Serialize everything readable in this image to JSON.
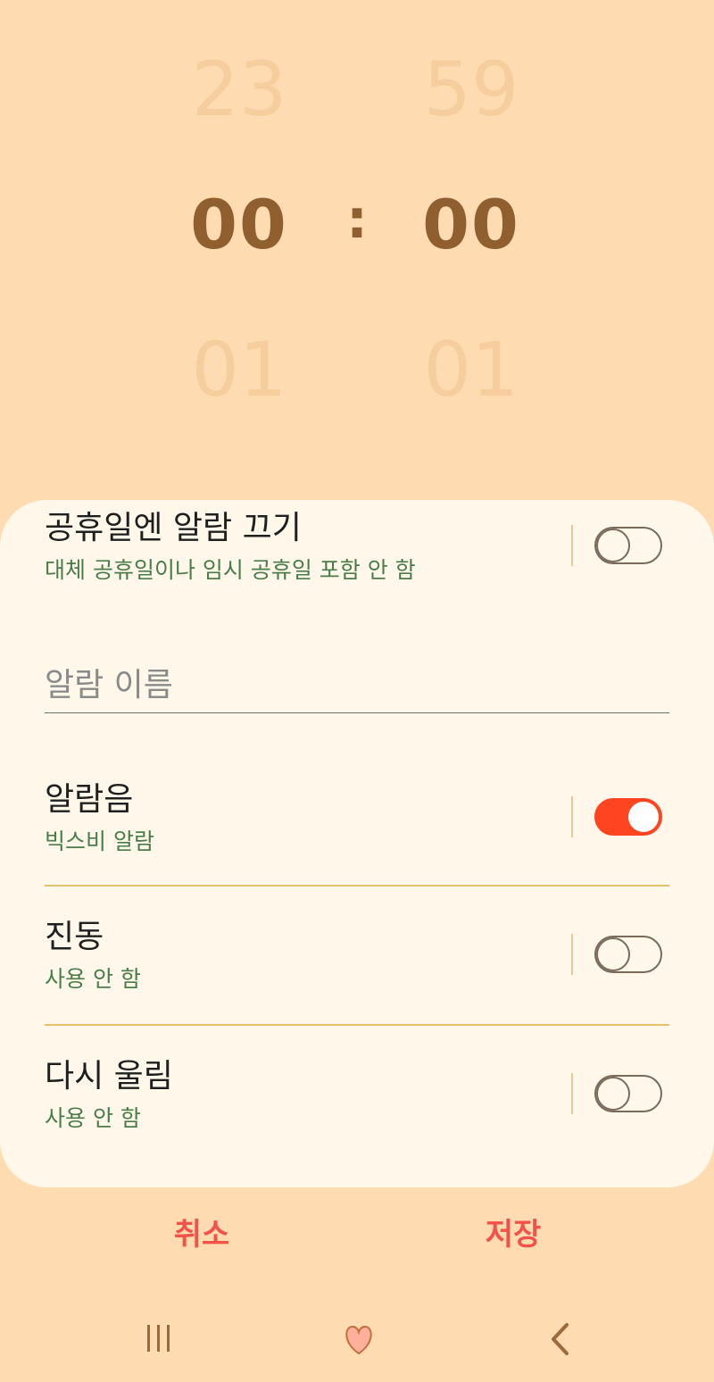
{
  "picker": {
    "hour_prev": "23",
    "hour_current": "00",
    "hour_next": "01",
    "separator": ":",
    "minute_prev": "59",
    "minute_current": "00",
    "minute_next": "01"
  },
  "settings": {
    "holiday": {
      "title": "공휴일엔 알람 끄기",
      "subtitle": "대체 공휴일이나 임시 공휴일 포함 안 함",
      "enabled": false
    },
    "alarm_name": {
      "value": "",
      "placeholder": "알람 이름"
    },
    "sound": {
      "title": "알람음",
      "subtitle": "빅스비 알람",
      "enabled": true
    },
    "vibration": {
      "title": "진동",
      "subtitle": "사용 안 함",
      "enabled": false
    },
    "snooze": {
      "title": "다시 울림",
      "subtitle": "사용 안 함",
      "enabled": false
    }
  },
  "actions": {
    "cancel_label": "취소",
    "save_label": "저장"
  },
  "nav": {
    "recents_icon": "recents-icon",
    "home_icon": "heart-home-icon",
    "back_icon": "back-chevron-icon"
  },
  "colors": {
    "background": "#fedbb0",
    "card": "#fff8ea",
    "accent_red": "#ff4420",
    "action_text": "#f2524a",
    "subtitle_green": "#4a7c4a",
    "picker_current": "#8f5f2f",
    "picker_faded": "#f6cd9c",
    "divider_gold": "#e6c06b"
  }
}
